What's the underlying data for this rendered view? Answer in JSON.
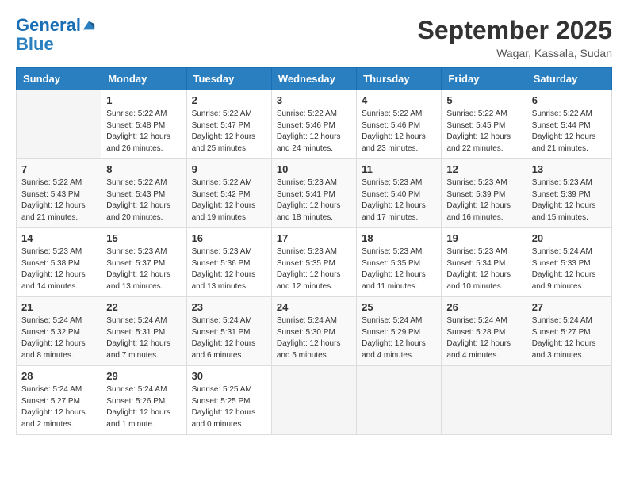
{
  "header": {
    "logo_line1": "General",
    "logo_line2": "Blue",
    "month_title": "September 2025",
    "location": "Wagar, Kassala, Sudan"
  },
  "days_of_week": [
    "Sunday",
    "Monday",
    "Tuesday",
    "Wednesday",
    "Thursday",
    "Friday",
    "Saturday"
  ],
  "weeks": [
    [
      {
        "day": "",
        "info": ""
      },
      {
        "day": "1",
        "info": "Sunrise: 5:22 AM\nSunset: 5:48 PM\nDaylight: 12 hours\nand 26 minutes."
      },
      {
        "day": "2",
        "info": "Sunrise: 5:22 AM\nSunset: 5:47 PM\nDaylight: 12 hours\nand 25 minutes."
      },
      {
        "day": "3",
        "info": "Sunrise: 5:22 AM\nSunset: 5:46 PM\nDaylight: 12 hours\nand 24 minutes."
      },
      {
        "day": "4",
        "info": "Sunrise: 5:22 AM\nSunset: 5:46 PM\nDaylight: 12 hours\nand 23 minutes."
      },
      {
        "day": "5",
        "info": "Sunrise: 5:22 AM\nSunset: 5:45 PM\nDaylight: 12 hours\nand 22 minutes."
      },
      {
        "day": "6",
        "info": "Sunrise: 5:22 AM\nSunset: 5:44 PM\nDaylight: 12 hours\nand 21 minutes."
      }
    ],
    [
      {
        "day": "7",
        "info": "Sunrise: 5:22 AM\nSunset: 5:43 PM\nDaylight: 12 hours\nand 21 minutes."
      },
      {
        "day": "8",
        "info": "Sunrise: 5:22 AM\nSunset: 5:43 PM\nDaylight: 12 hours\nand 20 minutes."
      },
      {
        "day": "9",
        "info": "Sunrise: 5:22 AM\nSunset: 5:42 PM\nDaylight: 12 hours\nand 19 minutes."
      },
      {
        "day": "10",
        "info": "Sunrise: 5:23 AM\nSunset: 5:41 PM\nDaylight: 12 hours\nand 18 minutes."
      },
      {
        "day": "11",
        "info": "Sunrise: 5:23 AM\nSunset: 5:40 PM\nDaylight: 12 hours\nand 17 minutes."
      },
      {
        "day": "12",
        "info": "Sunrise: 5:23 AM\nSunset: 5:39 PM\nDaylight: 12 hours\nand 16 minutes."
      },
      {
        "day": "13",
        "info": "Sunrise: 5:23 AM\nSunset: 5:39 PM\nDaylight: 12 hours\nand 15 minutes."
      }
    ],
    [
      {
        "day": "14",
        "info": "Sunrise: 5:23 AM\nSunset: 5:38 PM\nDaylight: 12 hours\nand 14 minutes."
      },
      {
        "day": "15",
        "info": "Sunrise: 5:23 AM\nSunset: 5:37 PM\nDaylight: 12 hours\nand 13 minutes."
      },
      {
        "day": "16",
        "info": "Sunrise: 5:23 AM\nSunset: 5:36 PM\nDaylight: 12 hours\nand 13 minutes."
      },
      {
        "day": "17",
        "info": "Sunrise: 5:23 AM\nSunset: 5:35 PM\nDaylight: 12 hours\nand 12 minutes."
      },
      {
        "day": "18",
        "info": "Sunrise: 5:23 AM\nSunset: 5:35 PM\nDaylight: 12 hours\nand 11 minutes."
      },
      {
        "day": "19",
        "info": "Sunrise: 5:23 AM\nSunset: 5:34 PM\nDaylight: 12 hours\nand 10 minutes."
      },
      {
        "day": "20",
        "info": "Sunrise: 5:24 AM\nSunset: 5:33 PM\nDaylight: 12 hours\nand 9 minutes."
      }
    ],
    [
      {
        "day": "21",
        "info": "Sunrise: 5:24 AM\nSunset: 5:32 PM\nDaylight: 12 hours\nand 8 minutes."
      },
      {
        "day": "22",
        "info": "Sunrise: 5:24 AM\nSunset: 5:31 PM\nDaylight: 12 hours\nand 7 minutes."
      },
      {
        "day": "23",
        "info": "Sunrise: 5:24 AM\nSunset: 5:31 PM\nDaylight: 12 hours\nand 6 minutes."
      },
      {
        "day": "24",
        "info": "Sunrise: 5:24 AM\nSunset: 5:30 PM\nDaylight: 12 hours\nand 5 minutes."
      },
      {
        "day": "25",
        "info": "Sunrise: 5:24 AM\nSunset: 5:29 PM\nDaylight: 12 hours\nand 4 minutes."
      },
      {
        "day": "26",
        "info": "Sunrise: 5:24 AM\nSunset: 5:28 PM\nDaylight: 12 hours\nand 4 minutes."
      },
      {
        "day": "27",
        "info": "Sunrise: 5:24 AM\nSunset: 5:27 PM\nDaylight: 12 hours\nand 3 minutes."
      }
    ],
    [
      {
        "day": "28",
        "info": "Sunrise: 5:24 AM\nSunset: 5:27 PM\nDaylight: 12 hours\nand 2 minutes."
      },
      {
        "day": "29",
        "info": "Sunrise: 5:24 AM\nSunset: 5:26 PM\nDaylight: 12 hours\nand 1 minute."
      },
      {
        "day": "30",
        "info": "Sunrise: 5:25 AM\nSunset: 5:25 PM\nDaylight: 12 hours\nand 0 minutes."
      },
      {
        "day": "",
        "info": ""
      },
      {
        "day": "",
        "info": ""
      },
      {
        "day": "",
        "info": ""
      },
      {
        "day": "",
        "info": ""
      }
    ]
  ]
}
